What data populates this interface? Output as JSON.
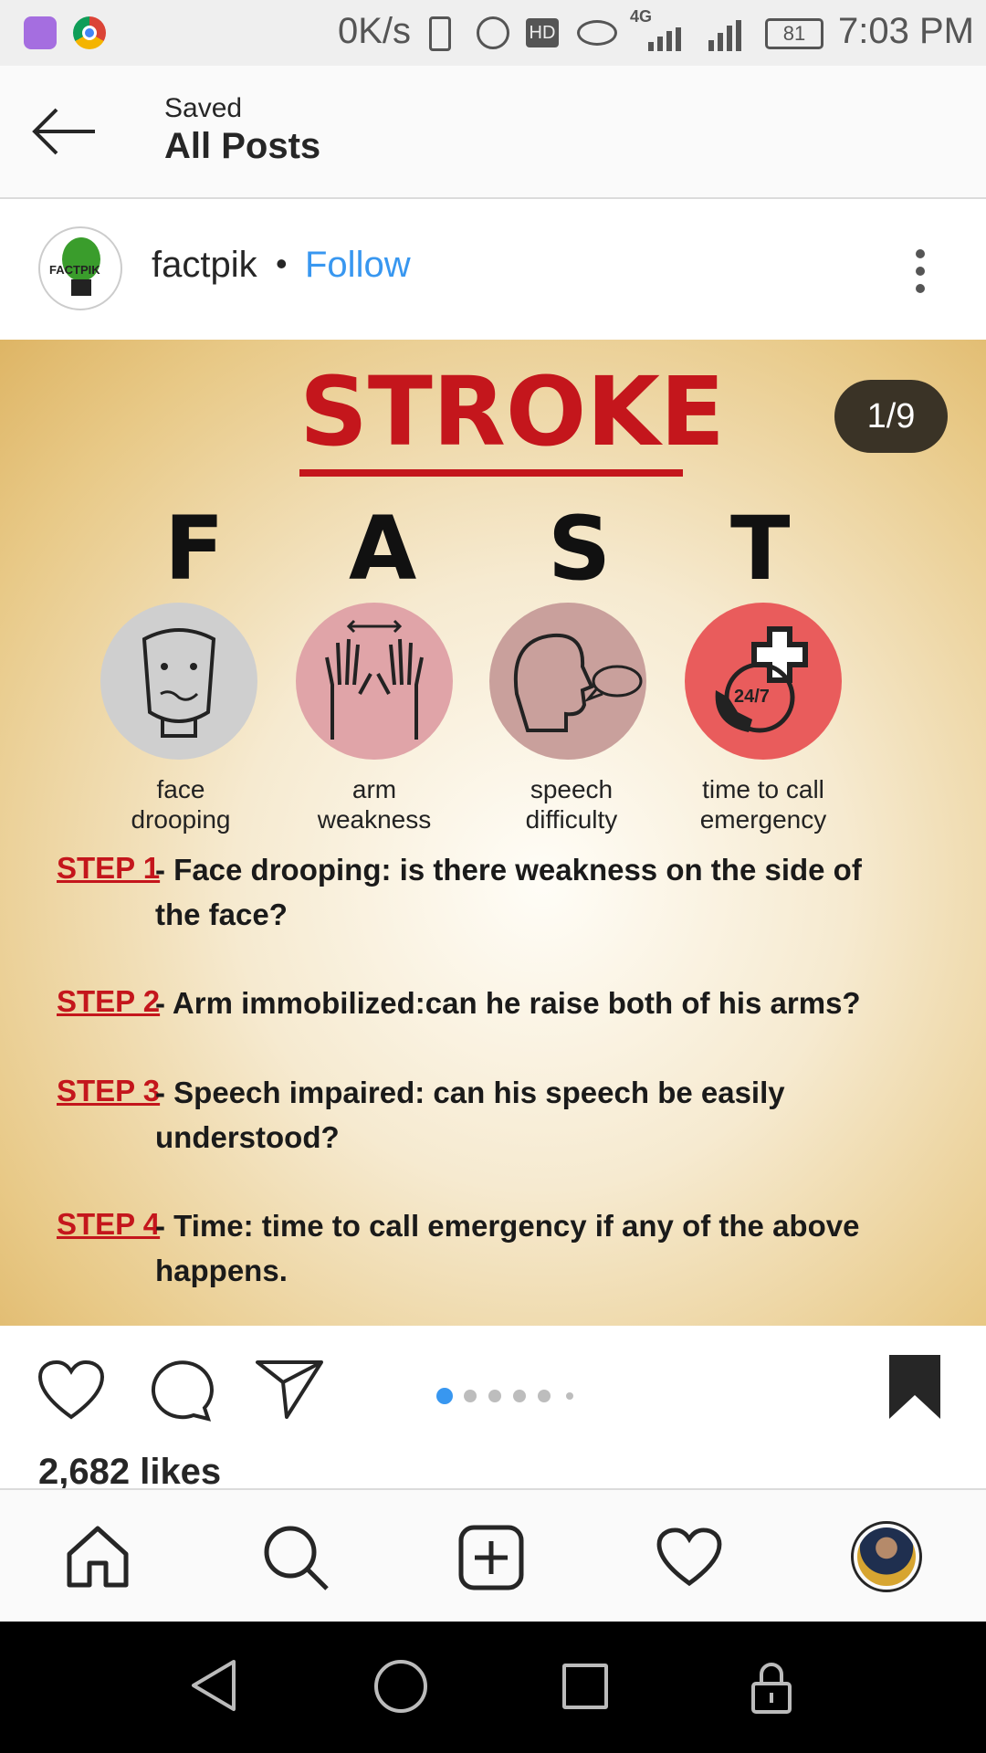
{
  "status_bar": {
    "speed": "0K/s",
    "network": "4G",
    "battery": "81",
    "time": "7:03 PM"
  },
  "header": {
    "subtitle": "Saved",
    "title": "All Posts"
  },
  "post": {
    "username": "factpik",
    "separator": "•",
    "follow_label": "Follow",
    "avatar_text": "FACTPIK",
    "page_counter": "1/9",
    "likes": "2,682 likes",
    "carousel_total_dots": 6,
    "carousel_active_index": 0
  },
  "infographic": {
    "title": "STROKE",
    "letters": [
      "F",
      "A",
      "S",
      "T"
    ],
    "badge": "24/7",
    "captions": [
      {
        "line1": "face",
        "line2": "drooping"
      },
      {
        "line1": "arm",
        "line2": "weakness"
      },
      {
        "line1": "speech",
        "line2": "difficulty"
      },
      {
        "line1": "time to call",
        "line2": "emergency"
      }
    ],
    "steps": [
      {
        "label": "STEP 1",
        "text": "- Face drooping: is there weakness on the side of the face?"
      },
      {
        "label": "STEP 2",
        "text": "- Arm immobilized:can he raise both of his arms?"
      },
      {
        "label": "STEP 3",
        "text": "- Speech impaired: can his speech be easily understood?"
      },
      {
        "label": "STEP 4",
        "text": "- Time: time to call emergency if any of the above happens."
      }
    ]
  },
  "colors": {
    "follow_blue": "#3897f0",
    "stroke_red": "#c4161c",
    "counter_bg": "#3a3326"
  }
}
